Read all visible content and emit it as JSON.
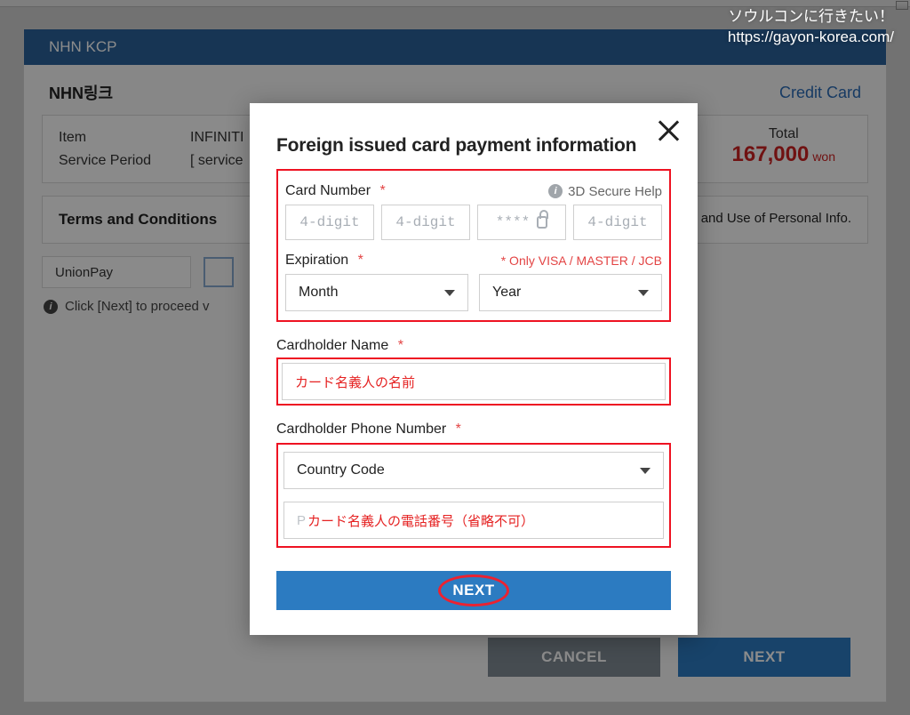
{
  "watermark": {
    "line1": "ソウルコンに行きたい！",
    "line2": "https://gayon-korea.com/"
  },
  "header": {
    "brand": "NHN KCP"
  },
  "subheader": {
    "title": "NHN링크",
    "right_link": "Credit Card"
  },
  "summary": {
    "item_label": "Item",
    "item_value": "INFINITI",
    "period_label": "Service Period",
    "period_value": "[ service",
    "total_label": "Total",
    "price": "167,000",
    "currency": "won"
  },
  "terms": {
    "title": "Terms and Conditions",
    "right_text": "oll. and Use of Personal Info."
  },
  "pay": {
    "option_label": "UnionPay",
    "hint": "Click [Next] to proceed v"
  },
  "bottom": {
    "cancel": "CANCEL",
    "next": "NEXT"
  },
  "modal": {
    "title": "Foreign issued card payment information",
    "card_number_label": "Card Number",
    "secure_help": "3D Secure Help",
    "quad_placeholder": "4-digit",
    "masked_placeholder": "****",
    "expiration_label": "Expiration",
    "only_note": "* Only VISA / MASTER / JCB",
    "month": "Month",
    "year": "Year",
    "name_label": "Cardholder Name",
    "name_annotation": "カード名義人の名前",
    "phone_label": "Cardholder Phone Number",
    "country_code": "Country Code",
    "phone_ghost": "P",
    "phone_annotation": "カード名義人の電話番号（省略不可）",
    "next_label": "NEXT",
    "required_mark": "*"
  }
}
